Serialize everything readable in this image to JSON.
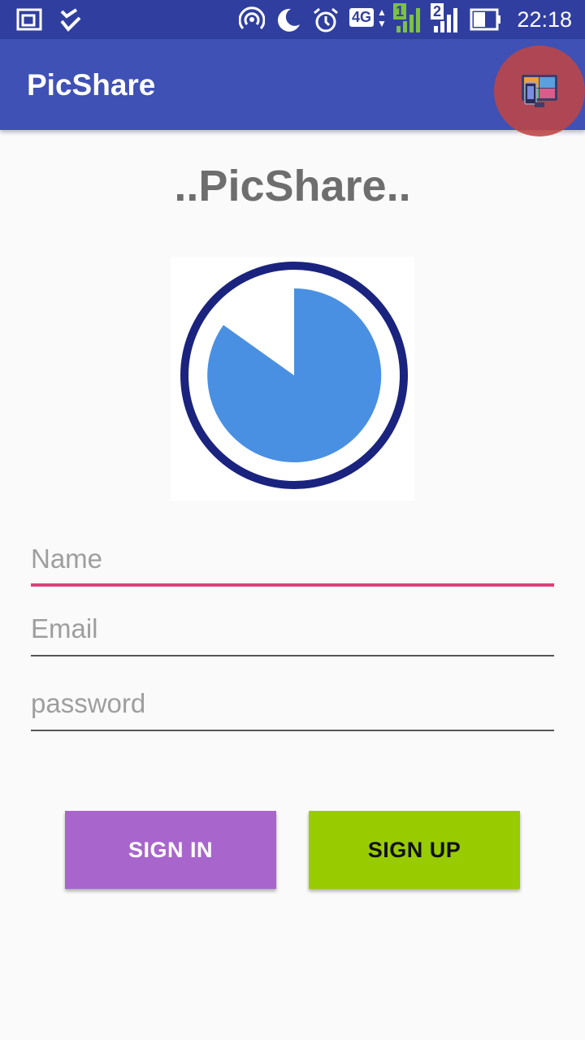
{
  "status_bar": {
    "time": "22:18",
    "network_type": "4G",
    "sim1_label": "1",
    "sim2_label": "2",
    "icons": [
      "screen-mirror-icon",
      "check-app-icon",
      "hotspot-icon",
      "moon-icon",
      "alarm-icon",
      "signal-icon",
      "battery-icon"
    ]
  },
  "app_bar": {
    "title": "PicShare"
  },
  "overlay": {
    "icon": "screen-cast-icon"
  },
  "main": {
    "heading": "..PicShare.."
  },
  "form": {
    "name_placeholder": "Name",
    "email_placeholder": "Email",
    "password_placeholder": "password"
  },
  "buttons": {
    "sign_in": "SIGN IN",
    "sign_up": "SIGN UP"
  },
  "colors": {
    "primary": "#3f51b5",
    "primary_dark": "#303f9f",
    "accent": "#e0407a",
    "sign_in": "#a866cc",
    "sign_up": "#99cc00",
    "logo_ring": "#1a237e",
    "logo_fill": "#4a90e2"
  }
}
